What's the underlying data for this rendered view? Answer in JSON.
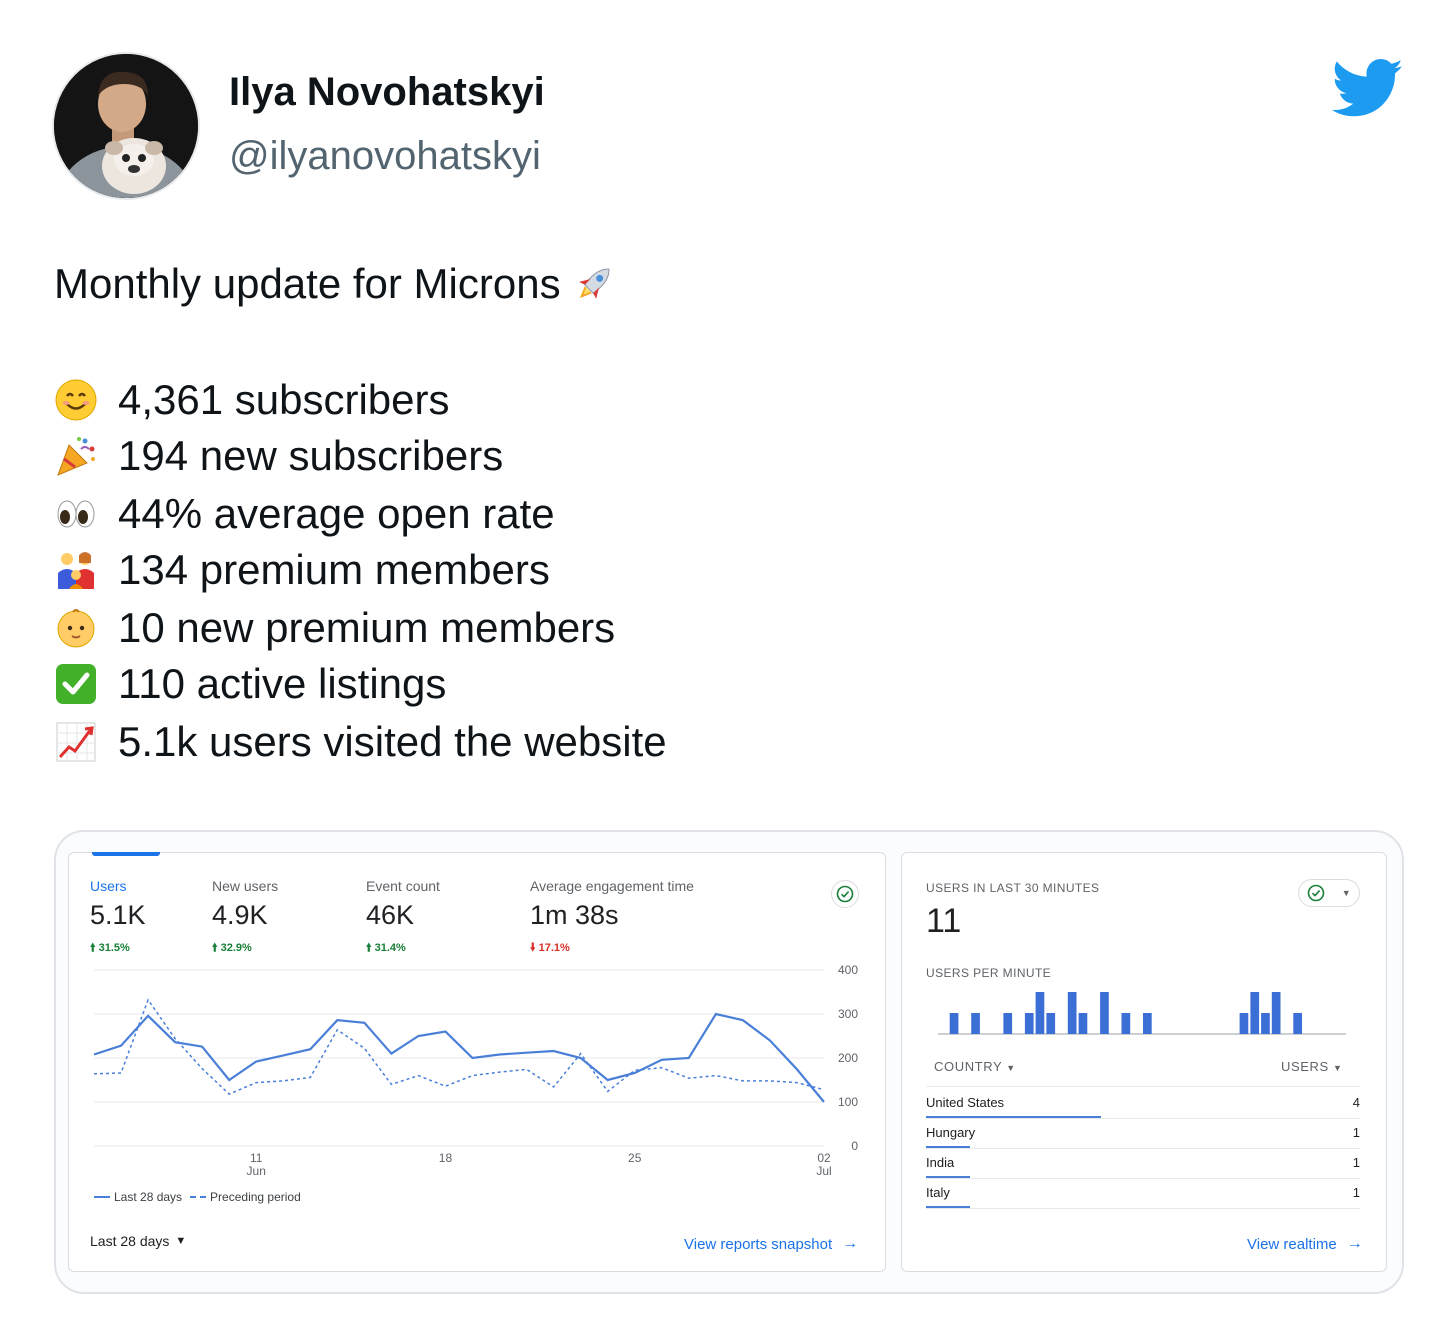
{
  "author": {
    "name": "Ilya Novohatskyi",
    "handle": "@ilyanovohatskyi"
  },
  "tweet": {
    "title": "Monthly update for Microns",
    "title_icon": "rocket-emoji",
    "stats": [
      {
        "icon": "smiling-face-emoji",
        "text": "4,361 subscribers"
      },
      {
        "icon": "party-popper-emoji",
        "text": "194 new subscribers"
      },
      {
        "icon": "eyes-emoji",
        "text": "44% average open rate"
      },
      {
        "icon": "family-emoji",
        "text": "134 premium members"
      },
      {
        "icon": "baby-emoji",
        "text": "10 new premium members"
      },
      {
        "icon": "check-mark-button-emoji",
        "text": "110 active listings"
      },
      {
        "icon": "chart-increasing-emoji",
        "text": "5.1k users visited the website"
      }
    ]
  },
  "analytics": {
    "metrics": [
      {
        "label": "Users",
        "value": "5.1K",
        "delta": "31.5%",
        "trend": "up"
      },
      {
        "label": "New users",
        "value": "4.9K",
        "delta": "32.9%",
        "trend": "up"
      },
      {
        "label": "Event count",
        "value": "46K",
        "delta": "31.4%",
        "trend": "up"
      },
      {
        "label": "Average engagement time",
        "value": "1m 38s",
        "delta": "17.1%",
        "trend": "down"
      }
    ],
    "legend": {
      "current": "Last 28 days",
      "previous": "Preceding period"
    },
    "date_range": "Last 28 days",
    "view_link": "View reports snapshot",
    "colors": {
      "accent": "#1a73e8",
      "line": "#4a7fd8",
      "up": "#188038",
      "down": "#d93025"
    }
  },
  "chart_data": [
    {
      "type": "line",
      "title": "",
      "x_tick_labels": [
        {
          "day": "11",
          "month": "Jun"
        },
        {
          "day": "18",
          "month": ""
        },
        {
          "day": "25",
          "month": ""
        },
        {
          "day": "02",
          "month": "Jul"
        }
      ],
      "y_tick_labels": [
        "400",
        "300",
        "200",
        "100",
        "0"
      ],
      "ylim": [
        0,
        400
      ],
      "grid": true,
      "legend_position": "bottom-left",
      "series": [
        {
          "name": "Last 28 days",
          "style": "solid",
          "values": [
            208,
            228,
            296,
            236,
            226,
            150,
            192,
            206,
            220,
            286,
            280,
            210,
            250,
            260,
            200,
            208,
            212,
            216,
            200,
            150,
            166,
            196,
            200,
            300,
            286,
            240,
            174,
            100
          ]
        },
        {
          "name": "Preceding period",
          "style": "dashed",
          "values": [
            164,
            166,
            332,
            244,
            176,
            118,
            144,
            148,
            156,
            264,
            222,
            140,
            160,
            136,
            160,
            168,
            174,
            134,
            210,
            124,
            172,
            178,
            154,
            160,
            148,
            148,
            144,
            128
          ]
        }
      ]
    },
    {
      "type": "bar",
      "title": "USERS PER MINUTE",
      "values": [
        0,
        1,
        0,
        1,
        0,
        0,
        1,
        0,
        1,
        2,
        1,
        0,
        2,
        1,
        0,
        2,
        0,
        1,
        0,
        1,
        0,
        0,
        0,
        0,
        0,
        0,
        0,
        0,
        1,
        2,
        1,
        2,
        0,
        1,
        0,
        0,
        0,
        0
      ]
    }
  ],
  "realtime": {
    "title": "USERS IN LAST 30 MINUTES",
    "count": "11",
    "per_minute_label": "USERS PER MINUTE",
    "country_header": "COUNTRY",
    "users_header": "USERS",
    "rows": [
      {
        "country": "United States",
        "users": "4",
        "share": 1.0
      },
      {
        "country": "Hungary",
        "users": "1",
        "share": 0.25
      },
      {
        "country": "India",
        "users": "1",
        "share": 0.25
      },
      {
        "country": "Italy",
        "users": "1",
        "share": 0.25
      }
    ],
    "view_link": "View realtime"
  }
}
